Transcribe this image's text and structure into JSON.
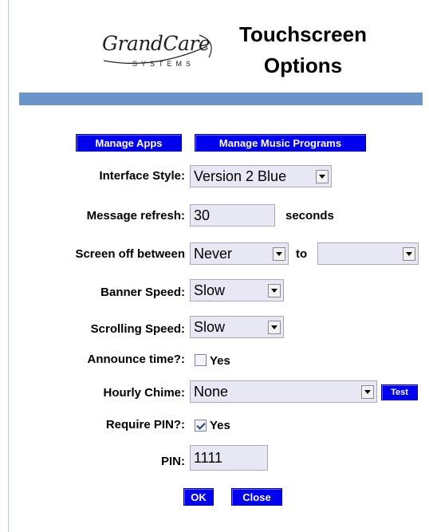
{
  "logo": {
    "script": "GrandCare",
    "sub": "SYSTEMS"
  },
  "title": {
    "line1": "Touchscreen",
    "line2": "Options"
  },
  "buttons": {
    "manage_apps": "Manage Apps",
    "manage_music": "Manage Music Programs",
    "test": "Test",
    "ok": "OK",
    "close": "Close"
  },
  "form": {
    "interface_style": {
      "label": "Interface Style:",
      "value": "Version 2 Blue"
    },
    "message_refresh": {
      "label": "Message refresh:",
      "value": "30",
      "unit": "seconds"
    },
    "screen_off": {
      "label": "Screen off between",
      "from": "Never",
      "to_label": "to",
      "to": ""
    },
    "banner_speed": {
      "label": "Banner Speed:",
      "value": "Slow"
    },
    "scrolling_speed": {
      "label": "Scrolling Speed:",
      "value": "Slow"
    },
    "announce_time": {
      "label": "Announce time?:",
      "checked": false,
      "option": "Yes"
    },
    "hourly_chime": {
      "label": "Hourly Chime:",
      "value": "None"
    },
    "require_pin": {
      "label": "Require PIN?:",
      "checked": true,
      "option": "Yes"
    },
    "pin": {
      "label": "PIN:",
      "value": "1111"
    }
  },
  "colors": {
    "band": "#6b95c8",
    "button": "#0000ee",
    "field": "#e8e8f4"
  }
}
